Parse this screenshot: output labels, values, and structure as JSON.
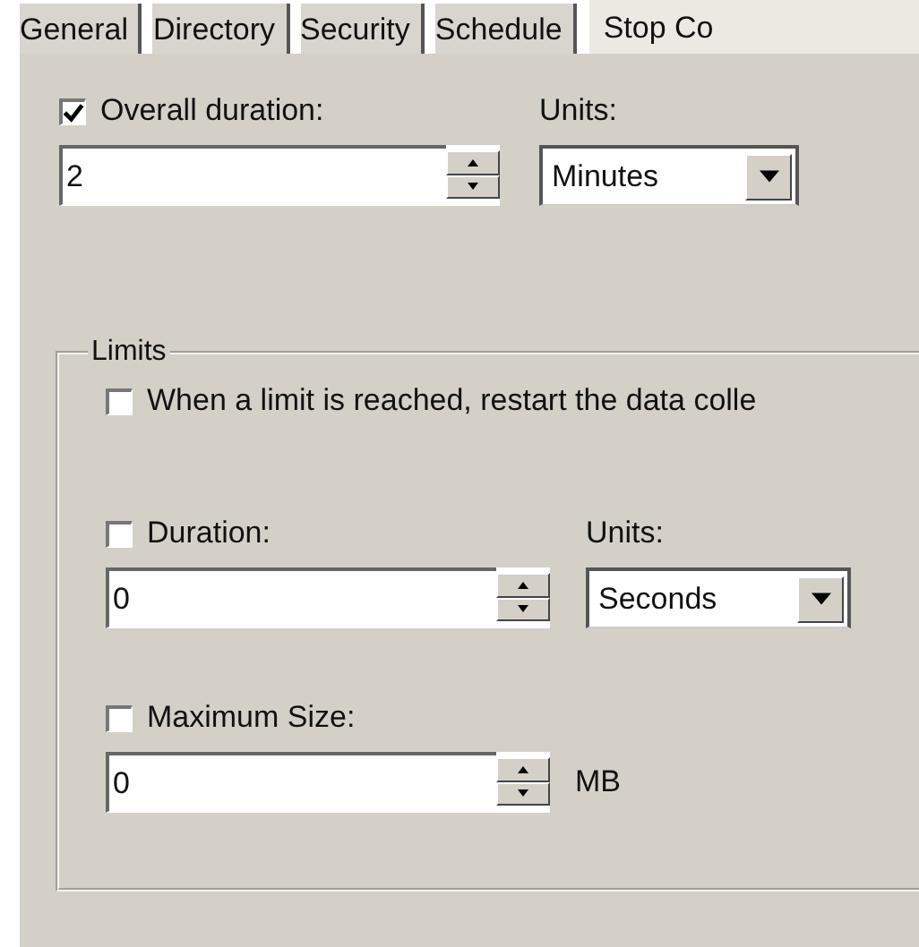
{
  "tabs": [
    {
      "label": "General",
      "selected": false
    },
    {
      "label": "Directory",
      "selected": false
    },
    {
      "label": "Security",
      "selected": false
    },
    {
      "label": "Schedule",
      "selected": false
    },
    {
      "label": "Stop Co",
      "selected": true
    }
  ],
  "overall_duration": {
    "label": "Overall duration:",
    "checked": true,
    "value": "2",
    "units_label": "Units:",
    "units_value": "Minutes"
  },
  "limits": {
    "title": "Limits",
    "restart": {
      "label": "When a limit is reached, restart the data colle",
      "checked": false
    },
    "duration": {
      "label": "Duration:",
      "checked": false,
      "value": "0",
      "units_label": "Units:",
      "units_value": "Seconds"
    },
    "maximum_size": {
      "label": "Maximum Size:",
      "checked": false,
      "value": "0",
      "unit": "MB"
    }
  }
}
